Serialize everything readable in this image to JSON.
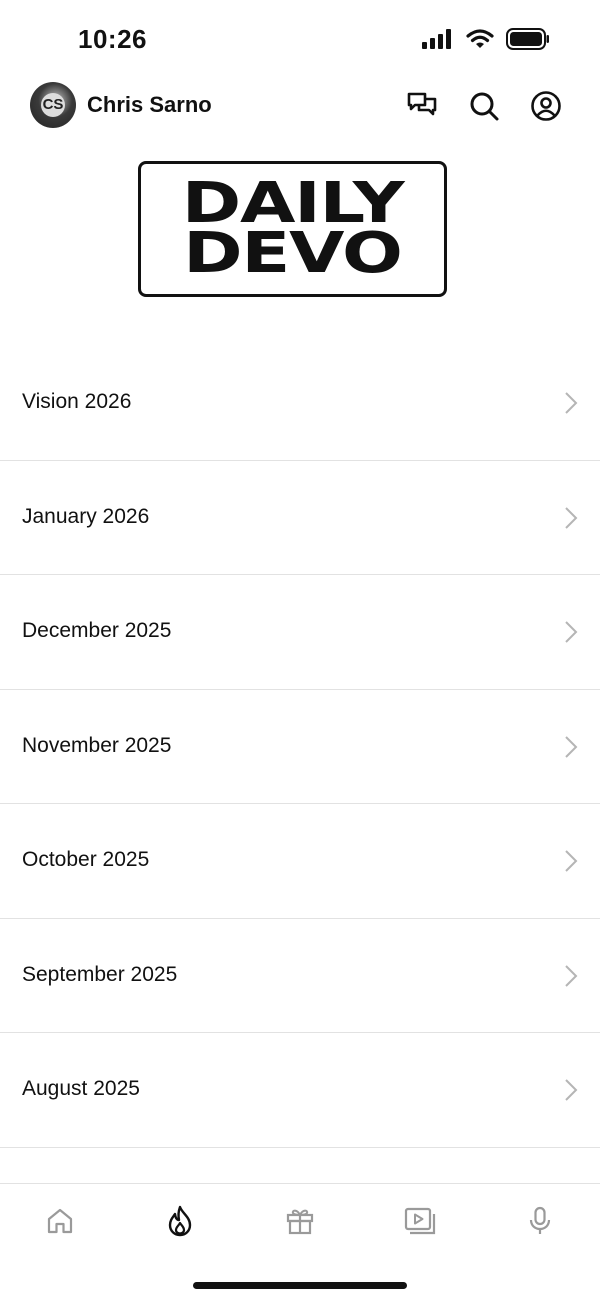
{
  "status": {
    "time": "10:26"
  },
  "header": {
    "user_name": "Chris Sarno",
    "avatar_initials": "CS"
  },
  "logo": {
    "line1": "DAILY",
    "line2": "DEVO"
  },
  "list": [
    {
      "label": "Vision 2026"
    },
    {
      "label": "January 2026"
    },
    {
      "label": "December 2025"
    },
    {
      "label": "November 2025"
    },
    {
      "label": "October 2025"
    },
    {
      "label": "September 2025"
    },
    {
      "label": "August 2025"
    }
  ],
  "tabs": [
    {
      "icon": "home-icon",
      "active": false
    },
    {
      "icon": "flame-icon",
      "active": true
    },
    {
      "icon": "gift-icon",
      "active": false
    },
    {
      "icon": "media-icon",
      "active": false
    },
    {
      "icon": "microphone-icon",
      "active": false
    }
  ],
  "colors": {
    "active": "#111111",
    "inactive": "#9a9a9a",
    "divider": "#e2e2e2"
  }
}
